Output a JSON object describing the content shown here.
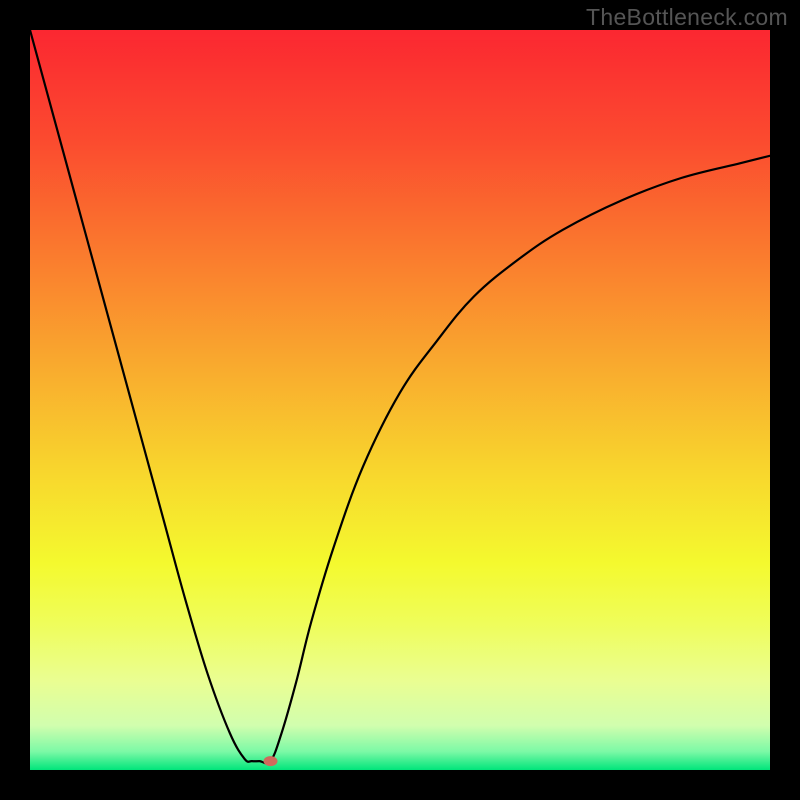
{
  "watermark": "TheBottleneck.com",
  "chart_data": {
    "type": "line",
    "title": "",
    "xlabel": "",
    "ylabel": "",
    "xlim": [
      0,
      100
    ],
    "ylim": [
      0,
      100
    ],
    "background_gradient": {
      "stops": [
        {
          "offset": 0.0,
          "color": "#fb2731"
        },
        {
          "offset": 0.15,
          "color": "#fb4b2f"
        },
        {
          "offset": 0.3,
          "color": "#fa7a2e"
        },
        {
          "offset": 0.45,
          "color": "#f9a92e"
        },
        {
          "offset": 0.6,
          "color": "#f8d72d"
        },
        {
          "offset": 0.72,
          "color": "#f4f92e"
        },
        {
          "offset": 0.8,
          "color": "#effd59"
        },
        {
          "offset": 0.88,
          "color": "#eafe92"
        },
        {
          "offset": 0.94,
          "color": "#d1feae"
        },
        {
          "offset": 0.975,
          "color": "#7cf9a6"
        },
        {
          "offset": 1.0,
          "color": "#00e57b"
        }
      ]
    },
    "series": [
      {
        "name": "bottleneck-curve",
        "x": [
          0,
          3,
          6,
          9,
          12,
          15,
          18,
          21,
          24,
          27,
          29,
          30,
          31,
          32.5,
          34,
          36,
          38,
          41,
          45,
          50,
          55,
          60,
          66,
          72,
          80,
          88,
          96,
          100
        ],
        "y": [
          100,
          89,
          78,
          67,
          56,
          45,
          34,
          23,
          13,
          5,
          1.5,
          1.2,
          1.2,
          1.2,
          5,
          12,
          20,
          30,
          41,
          51,
          58,
          64,
          69,
          73,
          77,
          80,
          82,
          83
        ]
      }
    ],
    "marker": {
      "x": 32.5,
      "y": 1.2,
      "color": "#cf6a5c",
      "rx": 7,
      "ry": 5
    },
    "curve_color": "#000000",
    "curve_width": 2.2
  }
}
